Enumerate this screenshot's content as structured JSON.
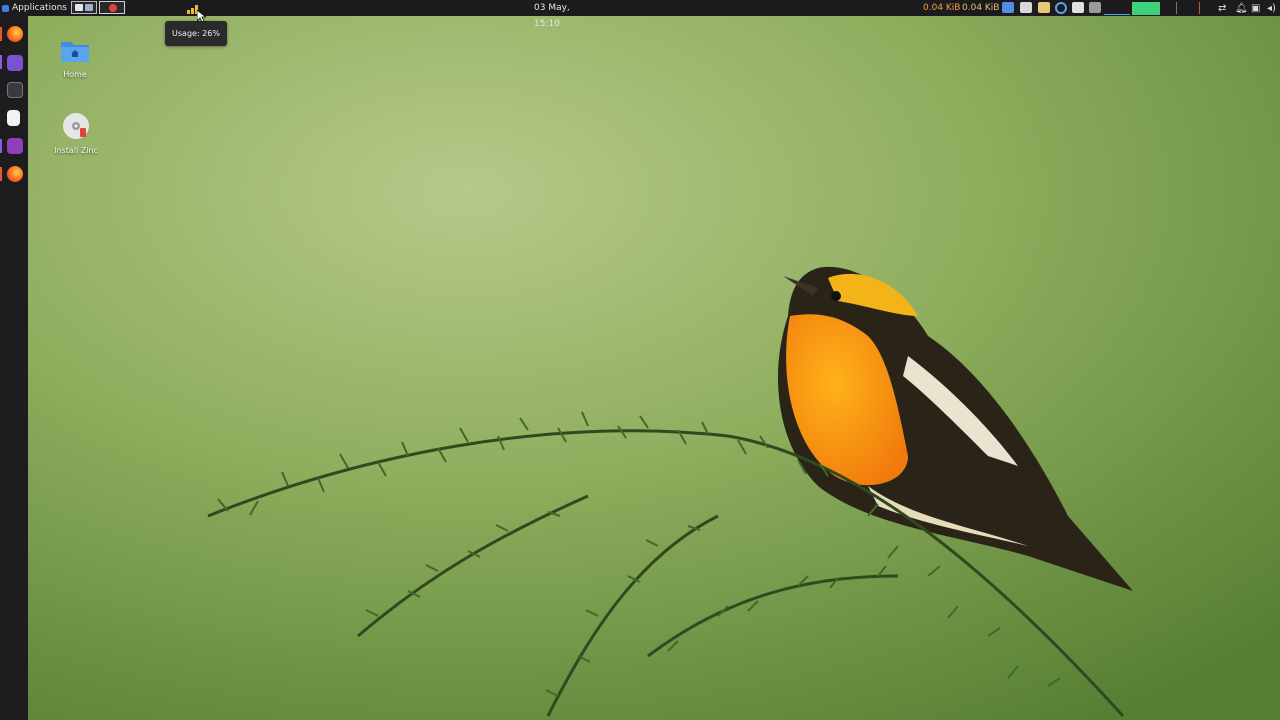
{
  "panel": {
    "applications_label": "Applications",
    "clock": "03 May, 15:10",
    "net_up": "0.04 KiB",
    "net_down": "0.04 KiB",
    "cpu_bars": [
      40,
      70,
      100
    ]
  },
  "tooltip": {
    "text": "Usage: 26%"
  },
  "dock": {
    "items": [
      {
        "name": "firefox"
      },
      {
        "name": "files"
      },
      {
        "name": "terminal"
      },
      {
        "name": "text-editor"
      },
      {
        "name": "settings"
      },
      {
        "name": "firefox"
      }
    ]
  },
  "desktop": {
    "icons": [
      {
        "label": "Home"
      },
      {
        "label": "Install Zinc"
      }
    ]
  },
  "colors": {
    "panel_bg": "#1c1c1e",
    "accent_orange": "#f0a03c",
    "dock_purple": "#8a5cd6"
  }
}
